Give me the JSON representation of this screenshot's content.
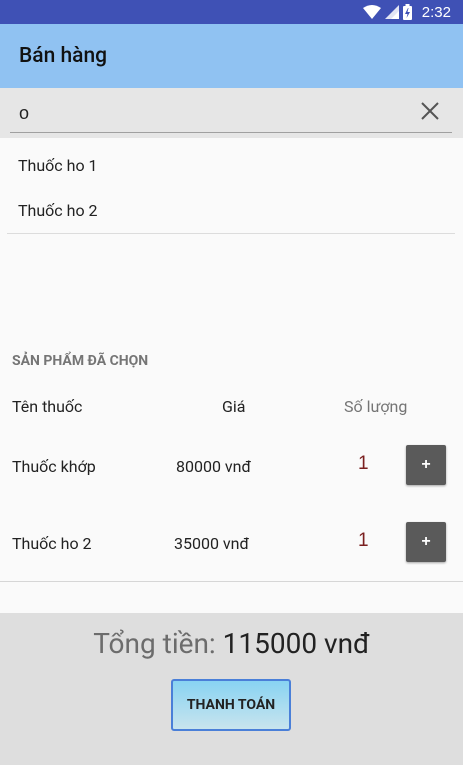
{
  "status_bar": {
    "time": "2:32",
    "icons": [
      "wifi-icon",
      "signal-icon",
      "battery-icon"
    ]
  },
  "app_bar": {
    "title": "Bán hàng"
  },
  "search": {
    "value": "o",
    "placeholder": ""
  },
  "search_results": [
    {
      "label": "Thuốc ho 1"
    },
    {
      "label": "Thuốc ho 2"
    }
  ],
  "cart": {
    "section_title": "SẢN PHẨM ĐÃ CHỌN",
    "columns": {
      "name": "Tên thuốc",
      "price": "Giá",
      "quantity": "Số lượng"
    },
    "rows": [
      {
        "name": "Thuốc khớp",
        "price": "80000 vnđ",
        "quantity": "1",
        "plus_label": "+"
      },
      {
        "name": "Thuốc ho 2",
        "price": "35000 vnđ",
        "quantity": "1",
        "plus_label": "+"
      }
    ]
  },
  "footer": {
    "total_label": "Tổng tiền:",
    "total_value": "115000 vnđ",
    "pay_button": "THANH TOÁN"
  },
  "colors": {
    "status_bar": "#3f51b5",
    "app_bar": "#90c2f2",
    "plus_button": "#5a5a5a",
    "pay_button_border": "#4a7fd8",
    "quantity_text": "#7a1f1f"
  }
}
